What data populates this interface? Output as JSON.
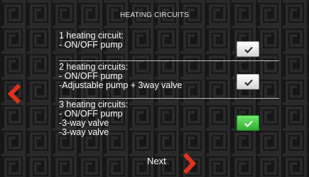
{
  "screen": {
    "title": "HEATING CIRCUITS"
  },
  "options": [
    {
      "title": "1 heating circuit:",
      "lines": [
        "- ON/OFF pump"
      ],
      "selected": false
    },
    {
      "title": "2 heating circuits:",
      "lines": [
        "- ON/OFF pump",
        "-Adjustable pump + 3way valve"
      ],
      "selected": false
    },
    {
      "title": "3 heating circuits:",
      "lines": [
        "- ON/OFF pump",
        "-3-way valve",
        "-3-way valve"
      ],
      "selected": true
    }
  ],
  "navigation": {
    "next_label": "Next",
    "back_icon": "chevron-left-icon",
    "next_icon": "chevron-right-icon"
  },
  "colors": {
    "accent": "#e0311b",
    "selected": "#3cc23c",
    "background": "#161616",
    "text": "#ffffff"
  }
}
